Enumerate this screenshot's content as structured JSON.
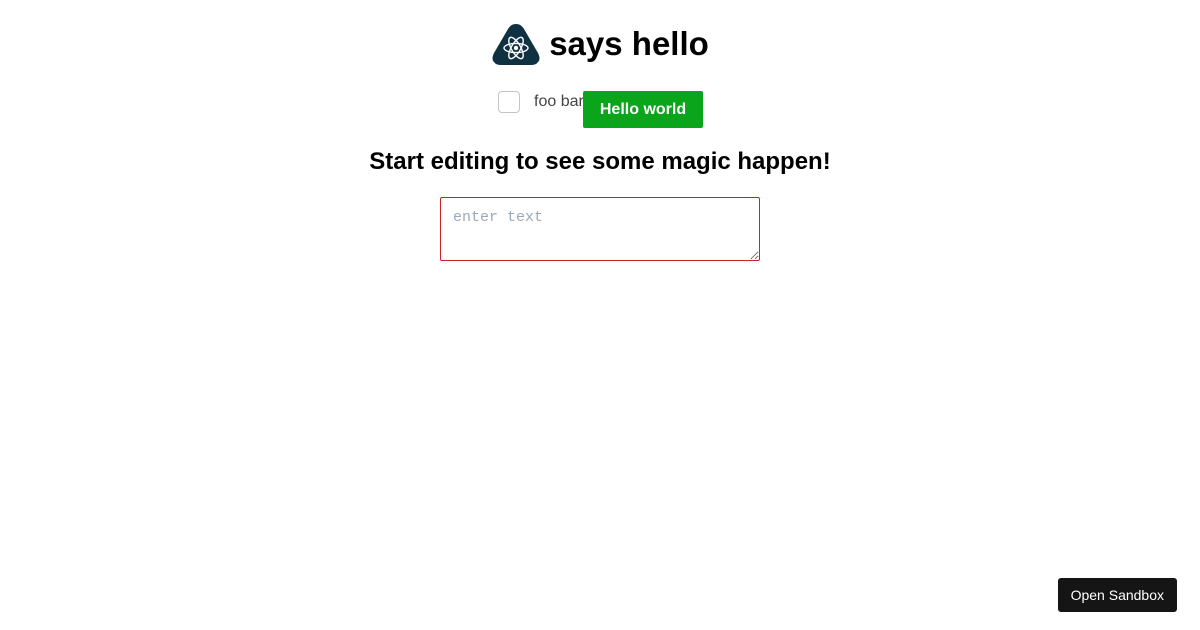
{
  "header": {
    "logo_icon": "react-atom-icon",
    "title": "says hello"
  },
  "controls": {
    "checkbox_checked": false,
    "checkbox_label": "foo bar",
    "hello_button_label": "Hello world"
  },
  "main": {
    "subtitle": "Start editing to see some magic happen!",
    "textarea": {
      "value": "",
      "placeholder": "enter text"
    }
  },
  "sandbox": {
    "button_label": "Open Sandbox"
  },
  "colors": {
    "logo_bg": "#0f3142",
    "hello_button": "#0aa51a",
    "textarea_border": "#cc2222",
    "sandbox_button": "#151515"
  }
}
